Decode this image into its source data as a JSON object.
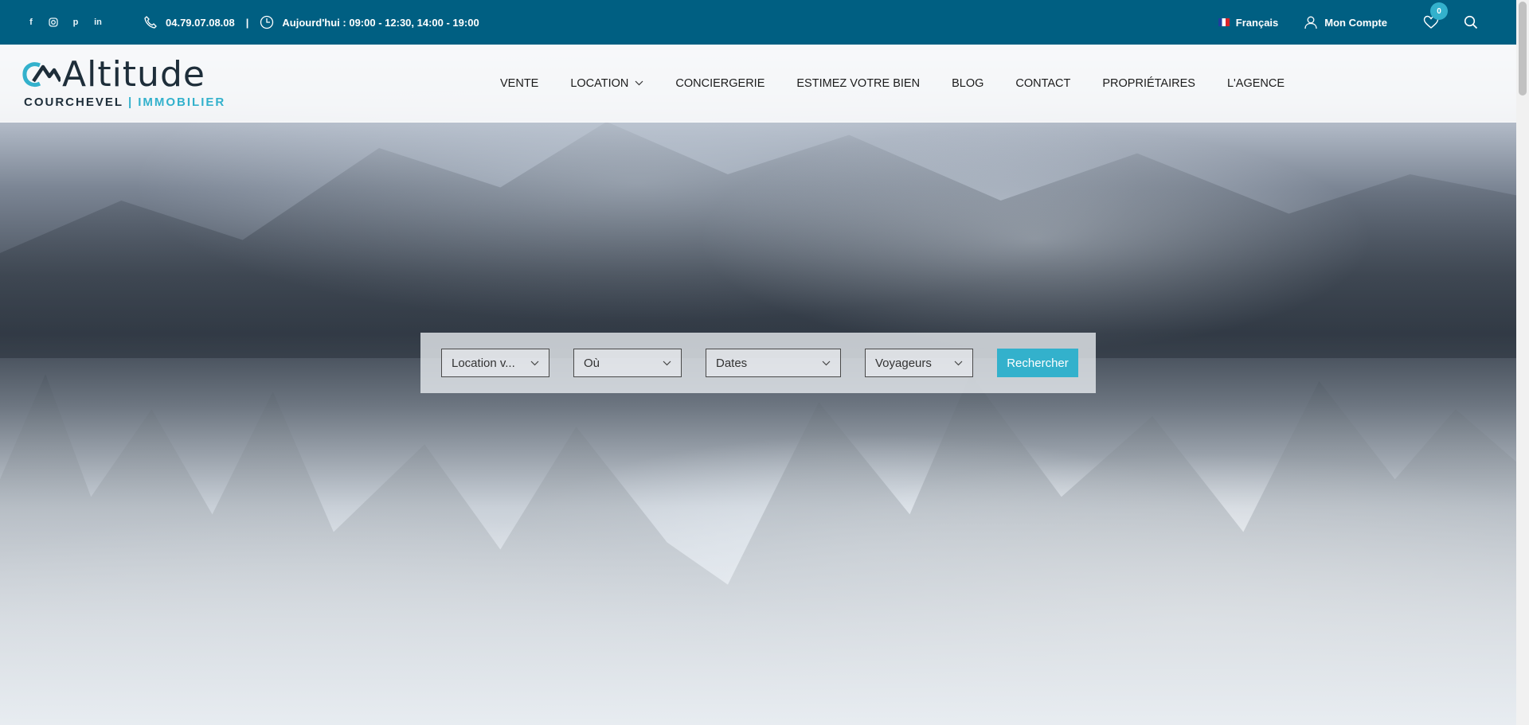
{
  "topbar": {
    "social_icons": [
      "facebook-icon",
      "instagram-icon",
      "pinterest-icon",
      "linkedin-icon"
    ],
    "phone": "04.79.07.08.08",
    "separator": "|",
    "hours": "Aujourd'hui : 09:00 - 12:30, 14:00 - 19:00",
    "language": "Français",
    "account": "Mon Compte",
    "wishlist_count": "0"
  },
  "logo": {
    "word": "Altitude",
    "sub_left": "COURCHEVEL",
    "sub_sep": "|",
    "sub_right": "IMMOBILIER"
  },
  "nav": {
    "items": [
      "VENTE",
      "LOCATION",
      "CONCIERGERIE",
      "ESTIMEZ VOTRE BIEN",
      "BLOG",
      "CONTACT",
      "PROPRIÉTAIRES",
      "L'AGENCE"
    ]
  },
  "search": {
    "type": "Location v...",
    "where": "Où",
    "dates": "Dates",
    "guests": "Voyageurs",
    "submit": "Rechercher"
  },
  "colors": {
    "topbar": "#005f82",
    "accent": "#33b1cc"
  }
}
